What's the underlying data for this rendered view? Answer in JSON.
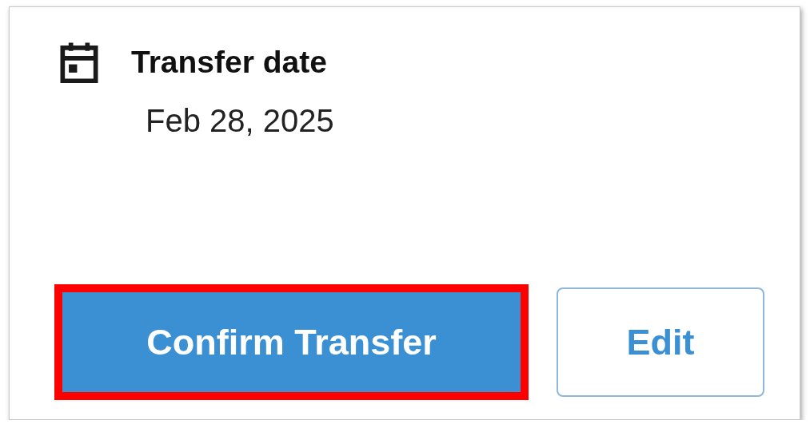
{
  "detail": {
    "label": "Transfer date",
    "value": "Feb 28, 2025"
  },
  "buttons": [
    {
      "label": "Confirm Transfer",
      "kind": "primary",
      "highlighted": true
    },
    {
      "label": "Edit",
      "kind": "secondary",
      "highlighted": false
    }
  ]
}
